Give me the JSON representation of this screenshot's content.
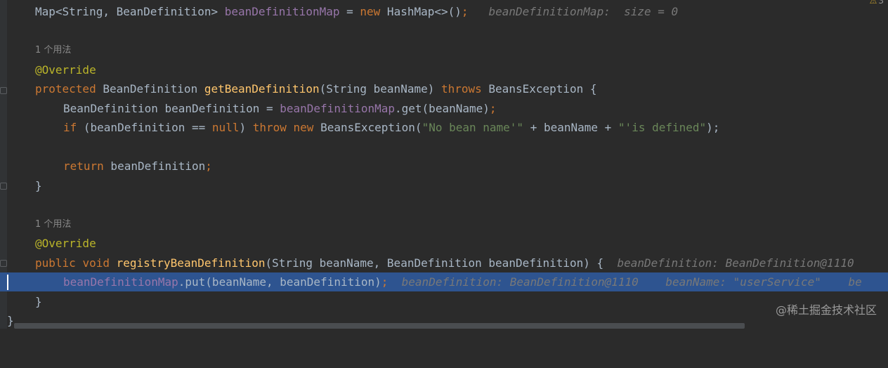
{
  "warnings": {
    "icon": "warning-icon",
    "count": "3"
  },
  "watermark": "@稀土掘金技术社区",
  "lines": {
    "l1": {
      "type1": "Map<String, BeanDefinition> ",
      "field": "beanDefinitionMap",
      "eq": " = ",
      "new": "new",
      "rest": " HashMap<>()",
      "semi": ";",
      "hint": "beanDefinitionMap:  size = 0"
    },
    "usage1": "1 个用法",
    "ann1": "@Override",
    "l4": {
      "kw": "protected",
      "type": " BeanDefinition ",
      "fn": "getBeanDefinition",
      "args": "(String beanName) ",
      "throws": "throws",
      "exc": " BeansException {"
    },
    "l5": {
      "decl": "BeanDefinition beanDefinition = ",
      "field": "beanDefinitionMap",
      "call": ".get(beanName)",
      "semi": ";"
    },
    "l6": {
      "if": "if",
      "cond": " (beanDefinition == ",
      "null": "null",
      "close": ") ",
      "throw": "throw",
      "sp": " ",
      "new": "new",
      "exc": " BeansException(",
      "s1": "\"No bean name'\"",
      "plus": " + beanName + ",
      "s2": "\"'is defined\"",
      "end": ");"
    },
    "l8": {
      "ret": "return",
      "val": " beanDefinition",
      "semi": ";"
    },
    "brace1": "}",
    "usage2": "1 个用法",
    "ann2": "@Override",
    "l13": {
      "pub": "public",
      "sp": " ",
      "void": "void",
      "sp2": " ",
      "fn": "registryBeanDefinition",
      "args": "(String beanName, BeanDefinition beanDefinition) {",
      "hint": "beanDefinition: BeanDefinition@1110"
    },
    "l14": {
      "field": "beanDefinitionMap",
      "call": ".put(beanName, beanDefinition)",
      "semi": ";",
      "hint1": "beanDefinition: BeanDefinition@1110",
      "hint2": "beanName: \"userService\"",
      "hint3": "be"
    },
    "brace2": "}",
    "brace3": "}"
  }
}
